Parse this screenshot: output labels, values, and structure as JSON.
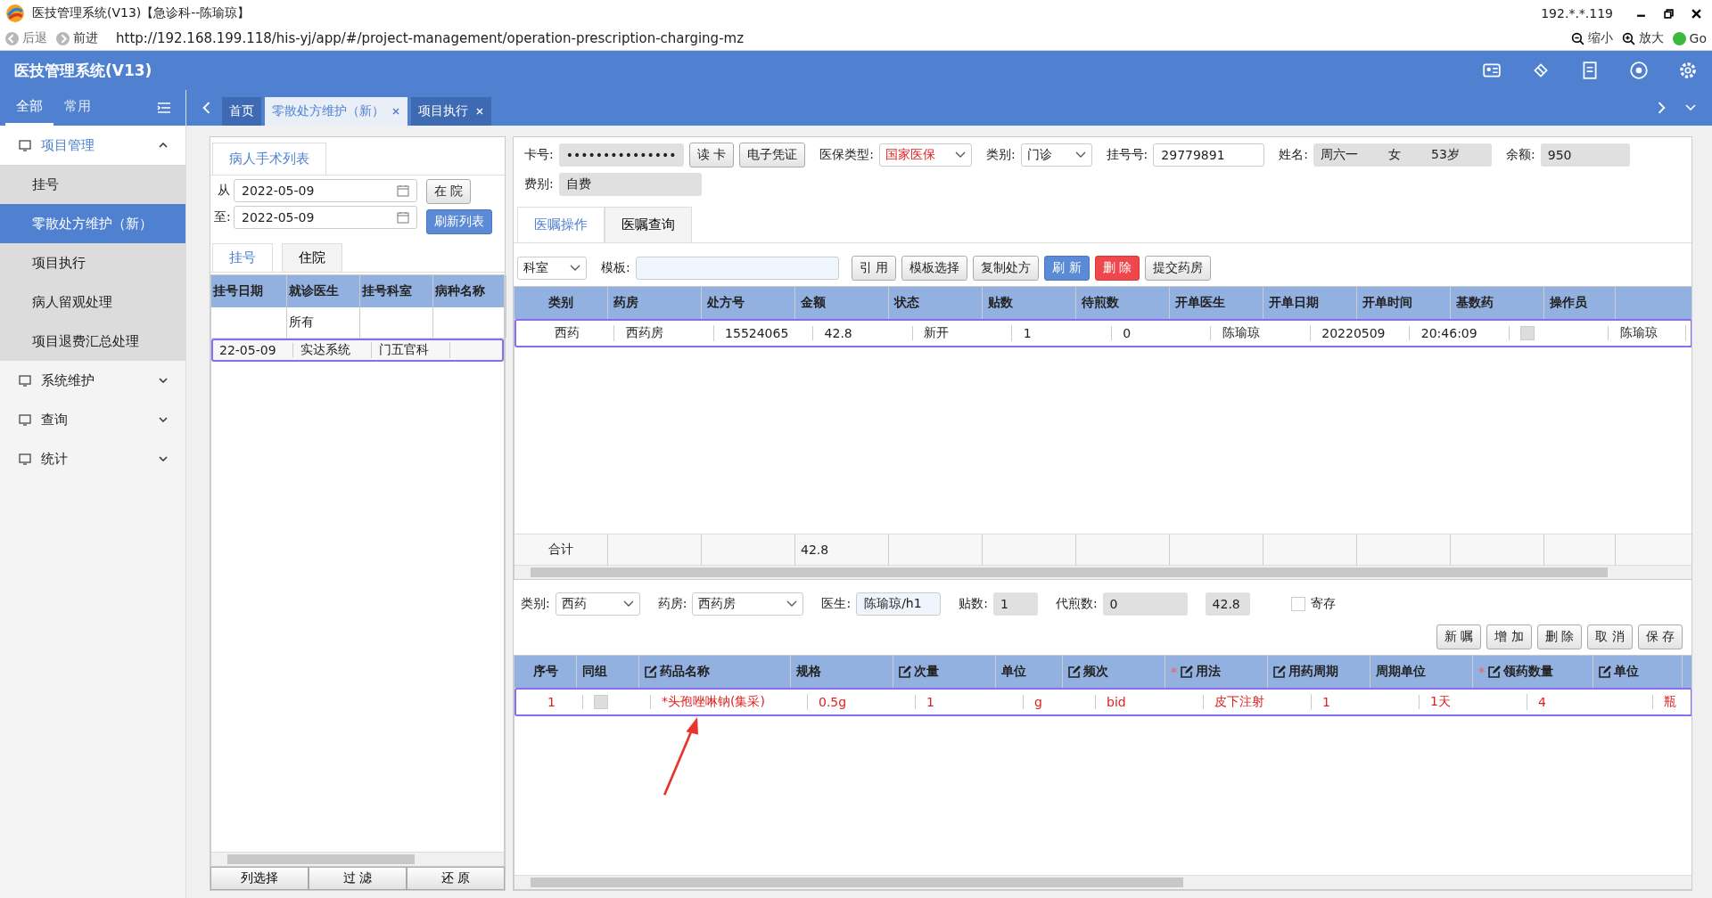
{
  "window": {
    "title": "医技管理系统(V13)【急诊科--陈瑜琼】",
    "ip": "192.*.*.119"
  },
  "browser": {
    "back": "后退",
    "forward": "前进",
    "url": "http://192.168.199.118/his-yj/app/#/project-management/operation-prescription-charging-mz",
    "zoom_out": "缩小",
    "zoom_in": "放大",
    "go": "Go"
  },
  "app": {
    "title": "医技管理系统(V13)"
  },
  "sidebar": {
    "tabs": [
      {
        "label": "全部",
        "selected": true
      },
      {
        "label": "常用",
        "selected": false
      }
    ],
    "items": [
      {
        "label": "项目管理",
        "expanded": true,
        "children": [
          {
            "label": "挂号",
            "selected": false
          },
          {
            "label": "零散处方维护（新）",
            "selected": true
          },
          {
            "label": "项目执行",
            "selected": false
          },
          {
            "label": "病人留观处理",
            "selected": false
          },
          {
            "label": "项目退费汇总处理",
            "selected": false
          }
        ]
      },
      {
        "label": "系统维护",
        "expanded": false
      },
      {
        "label": "查询",
        "expanded": false
      },
      {
        "label": "统计",
        "expanded": false
      }
    ]
  },
  "tabs": [
    {
      "label": "首页",
      "selected": false,
      "closable": false
    },
    {
      "label": "零散处方维护（新）",
      "selected": true,
      "closable": true
    },
    {
      "label": "项目执行",
      "selected": false,
      "closable": true
    }
  ],
  "patient_panel": {
    "title": "病人手术列表",
    "from_label": "从",
    "from": "2022-05-09",
    "to_label": "至:",
    "to": "2022-05-09",
    "buttons": [
      {
        "label": "在 院",
        "kind": "default"
      },
      {
        "label": "刷新列表",
        "kind": "primary"
      }
    ],
    "tabs": [
      {
        "label": "挂号",
        "selected": true
      },
      {
        "label": "住院",
        "selected": false
      }
    ],
    "columns": [
      "挂号日期",
      "就诊医生",
      "挂号科室",
      "病种名称"
    ],
    "rows": [
      {
        "cells": [
          null,
          "所有",
          null,
          null
        ],
        "selected": false
      },
      {
        "cells": [
          "22-05-09",
          "实达系统",
          "门五官科",
          null
        ],
        "selected": true
      }
    ],
    "footer_buttons": [
      "列选择",
      "过 滤",
      "还 原"
    ]
  },
  "patient": {
    "card": {
      "label": "卡号:",
      "value": "•••••••••••••••"
    },
    "card_buttons": [
      "读 卡",
      "电子凭证"
    ],
    "insurance": {
      "label": "医保类型:",
      "value": "国家医保"
    },
    "category": {
      "label": "类别:",
      "value": "门诊"
    },
    "reg_no": {
      "label": "挂号号:",
      "value": "29779891"
    },
    "name": {
      "label": "姓名:",
      "value": "周六一",
      "sex": "女",
      "age": "53岁"
    },
    "balance": {
      "label": "余额:",
      "value": "950"
    },
    "fee": {
      "label": "费别:",
      "value": "自费"
    }
  },
  "order_tabs": [
    {
      "label": "医嘱操作",
      "selected": true
    },
    {
      "label": "医嘱查询",
      "selected": false
    }
  ],
  "toolbar": {
    "dept": "科室",
    "template_label": "模板:",
    "buttons": [
      {
        "label": "引 用",
        "kind": "default"
      },
      {
        "label": "模板选择",
        "kind": "default"
      },
      {
        "label": "复制处方",
        "kind": "default"
      },
      {
        "label": "刷 新",
        "kind": "primary"
      },
      {
        "label": "删 除",
        "kind": "danger"
      },
      {
        "label": "提交药房",
        "kind": "default"
      }
    ]
  },
  "rx_table": {
    "columns": [
      "类别",
      "药房",
      "处方号",
      "金额",
      "状态",
      "贴数",
      "待煎数",
      "开单医生",
      "开单日期",
      "开单时间",
      "基数药",
      "操作员"
    ],
    "rows": [
      {
        "cells": [
          "西药",
          "西药房",
          "15524065",
          "42.8",
          "新开",
          "1",
          "0",
          "陈瑜琼",
          "20220509",
          "20:46:09"
        ],
        "base_drug": false,
        "operator": "陈瑜琼",
        "selected": true
      }
    ],
    "total": {
      "label": "合计",
      "amount": "42.8"
    }
  },
  "detail_form": {
    "category": {
      "label": "类别:",
      "value": "西药"
    },
    "pharmacy": {
      "label": "药房:",
      "value": "西药房"
    },
    "doctor": {
      "label": "医生:",
      "value": "陈瑜琼/h1"
    },
    "doses": {
      "label": "贴数:",
      "value": "1"
    },
    "decoct": {
      "label": "代煎数:",
      "value": "0"
    },
    "amount": "42.8",
    "deposit": {
      "label": "寄存",
      "checked": false
    }
  },
  "detail_buttons": [
    "新 嘱",
    "增 加",
    "删 除",
    "取 消",
    "保 存"
  ],
  "drug_table": {
    "columns": [
      {
        "label": "序号",
        "editable": false
      },
      {
        "label": "同组",
        "editable": false
      },
      {
        "label": "药品名称",
        "editable": true
      },
      {
        "label": "规格",
        "editable": false
      },
      {
        "label": "次量",
        "editable": true
      },
      {
        "label": "单位",
        "editable": false
      },
      {
        "label": "频次",
        "editable": true
      },
      {
        "label": "用法",
        "editable": true,
        "required_mark": "*"
      },
      {
        "label": "用药周期",
        "editable": true
      },
      {
        "label": "周期单位",
        "editable": false
      },
      {
        "label": "领药数量",
        "editable": true,
        "required_mark": "*"
      },
      {
        "label": "单位",
        "editable": true
      }
    ],
    "rows": [
      {
        "no": "1",
        "group": false,
        "values": [
          "*头孢唑啉钠(集采)",
          "0.5g",
          "1",
          "g",
          "bid",
          "皮下注射",
          "1",
          "1天",
          "4",
          "瓶"
        ],
        "selected": true
      }
    ]
  }
}
